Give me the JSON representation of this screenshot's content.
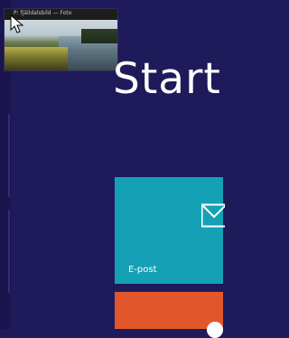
{
  "start_screen": {
    "heading": "Start"
  },
  "recent_app": {
    "title": "P: fjälldalsbild — Foto"
  },
  "tiles": {
    "mail": {
      "label": "E-post",
      "icon": "mail-icon",
      "color": "#15a1b5"
    },
    "second": {
      "icon": "circle-icon",
      "color": "#e1572b"
    }
  },
  "colors": {
    "background": "#1f1a5a"
  }
}
